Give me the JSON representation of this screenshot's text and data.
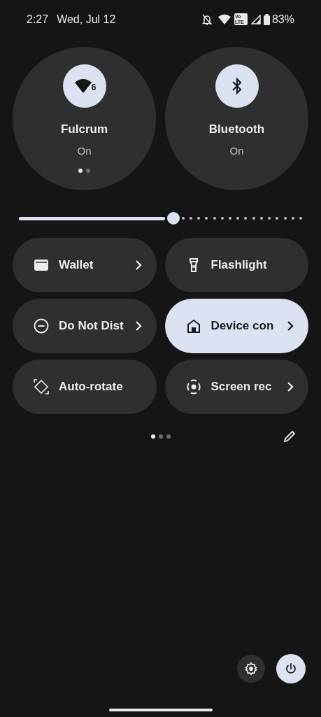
{
  "status_bar": {
    "time": "2:27",
    "date": "Wed, Jul 12",
    "volte": [
      "Vo",
      "LTE"
    ],
    "battery": "83%"
  },
  "big_tiles": [
    {
      "kind": "wifi",
      "label": "Fulcrum",
      "status": "On",
      "active": true,
      "badge": "6",
      "pages": [
        {
          "selected": true
        },
        {
          "selected": false
        }
      ]
    },
    {
      "kind": "bluetooth",
      "label": "Bluetooth",
      "status": "On",
      "active": true
    }
  ],
  "brightness": {
    "level": 0.545
  },
  "tiles": [
    {
      "kind": "wallet",
      "label": "Wallet",
      "active": false,
      "chevron": true
    },
    {
      "kind": "flashlight",
      "label": "Flashlight",
      "active": false,
      "chevron": false
    },
    {
      "kind": "dnd",
      "label": "Do Not Dist",
      "active": false,
      "chevron": true
    },
    {
      "kind": "home",
      "label": "Device con",
      "active": true,
      "chevron": true
    },
    {
      "kind": "rotate",
      "label": "Auto-rotate",
      "active": false,
      "chevron": false
    },
    {
      "kind": "record",
      "label": "Screen rec",
      "active": false,
      "chevron": true
    }
  ],
  "pages": [
    {
      "selected": true
    },
    {
      "selected": false
    },
    {
      "selected": false
    }
  ]
}
